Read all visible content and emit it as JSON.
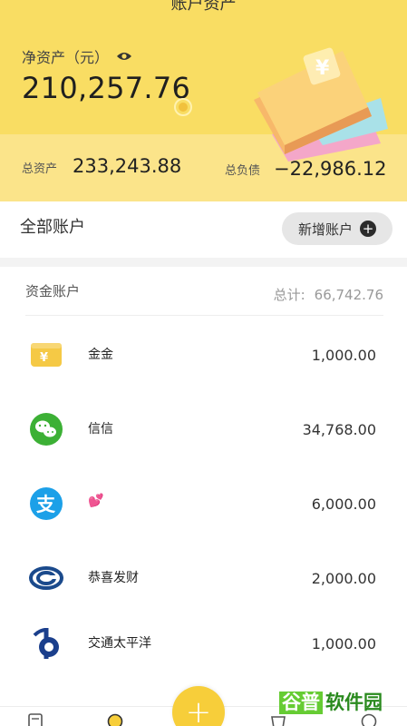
{
  "header": {
    "title": "账户资产",
    "net_assets_label": "净资产（元）",
    "net_assets_value": "210,257.76",
    "total_assets_label": "总资产",
    "total_assets_value": "233,243.88",
    "total_debt_label": "总负债",
    "total_debt_value": "−22,986.12"
  },
  "all_accounts": {
    "title": "全部账户",
    "add_button_label": "新增账户"
  },
  "fund_accounts": {
    "title": "资金账户",
    "total_label": "总计:",
    "total_value": "66,742.76"
  },
  "accounts": [
    {
      "name": "金金",
      "value": "1,000.00",
      "icon": "yuan-wallet-icon",
      "color": "#f5c945"
    },
    {
      "name": "信信",
      "value": "34,768.00",
      "icon": "wechat-icon",
      "color": "#3cb035"
    },
    {
      "name": "💕",
      "value": "6,000.00",
      "icon": "alipay-icon",
      "color": "#1ca0e8"
    },
    {
      "name": "恭喜发财",
      "value": "2,000.00",
      "icon": "unionpay-swirl-icon",
      "color": "#1b4a8c"
    },
    {
      "name": "交通太平洋",
      "value": "1,000.00",
      "icon": "bank-of-communications-icon",
      "color": "#1b3f8c"
    }
  ],
  "fab_label": "+",
  "watermark": {
    "part1": "谷普",
    "part2": "软件园"
  },
  "colors": {
    "accent": "#f9dd63",
    "fab": "#f7ce3a"
  }
}
